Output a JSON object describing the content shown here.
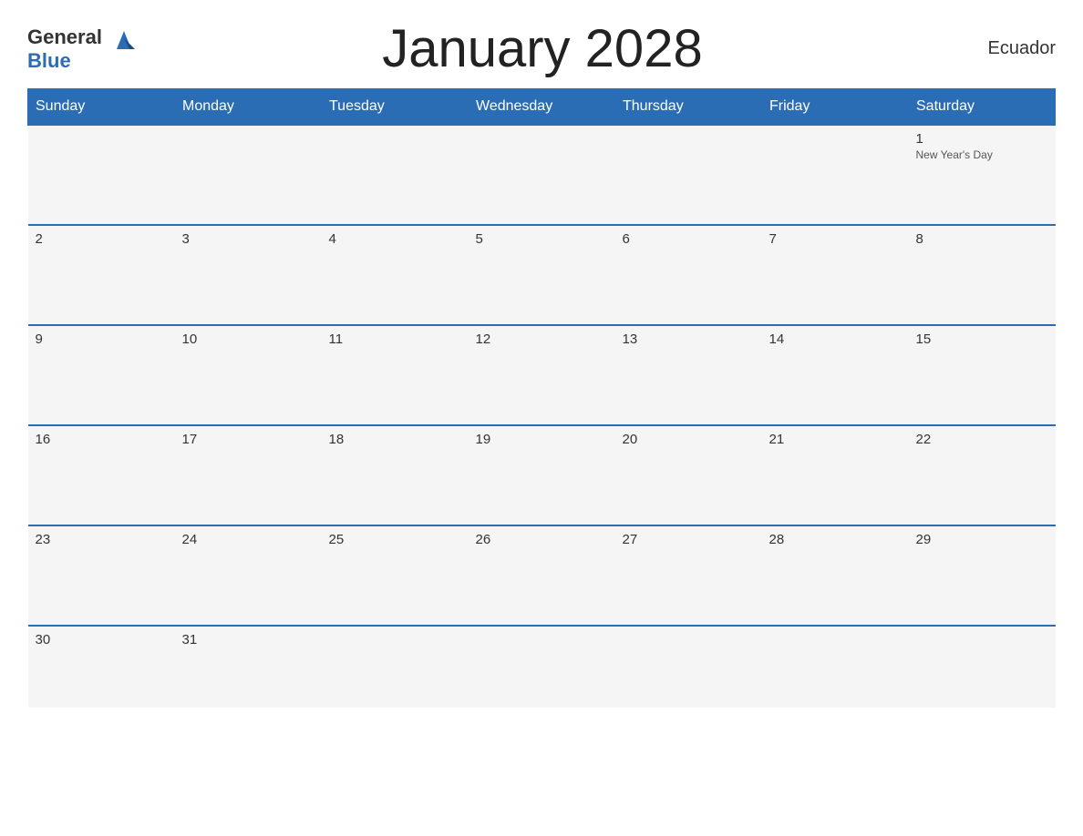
{
  "header": {
    "title": "January 2028",
    "country": "Ecuador",
    "logo": {
      "general": "General",
      "blue": "Blue"
    }
  },
  "days_of_week": [
    "Sunday",
    "Monday",
    "Tuesday",
    "Wednesday",
    "Thursday",
    "Friday",
    "Saturday"
  ],
  "weeks": [
    [
      {
        "day": "",
        "holiday": ""
      },
      {
        "day": "",
        "holiday": ""
      },
      {
        "day": "",
        "holiday": ""
      },
      {
        "day": "",
        "holiday": ""
      },
      {
        "day": "",
        "holiday": ""
      },
      {
        "day": "",
        "holiday": ""
      },
      {
        "day": "1",
        "holiday": "New Year's Day"
      }
    ],
    [
      {
        "day": "2",
        "holiday": ""
      },
      {
        "day": "3",
        "holiday": ""
      },
      {
        "day": "4",
        "holiday": ""
      },
      {
        "day": "5",
        "holiday": ""
      },
      {
        "day": "6",
        "holiday": ""
      },
      {
        "day": "7",
        "holiday": ""
      },
      {
        "day": "8",
        "holiday": ""
      }
    ],
    [
      {
        "day": "9",
        "holiday": ""
      },
      {
        "day": "10",
        "holiday": ""
      },
      {
        "day": "11",
        "holiday": ""
      },
      {
        "day": "12",
        "holiday": ""
      },
      {
        "day": "13",
        "holiday": ""
      },
      {
        "day": "14",
        "holiday": ""
      },
      {
        "day": "15",
        "holiday": ""
      }
    ],
    [
      {
        "day": "16",
        "holiday": ""
      },
      {
        "day": "17",
        "holiday": ""
      },
      {
        "day": "18",
        "holiday": ""
      },
      {
        "day": "19",
        "holiday": ""
      },
      {
        "day": "20",
        "holiday": ""
      },
      {
        "day": "21",
        "holiday": ""
      },
      {
        "day": "22",
        "holiday": ""
      }
    ],
    [
      {
        "day": "23",
        "holiday": ""
      },
      {
        "day": "24",
        "holiday": ""
      },
      {
        "day": "25",
        "holiday": ""
      },
      {
        "day": "26",
        "holiday": ""
      },
      {
        "day": "27",
        "holiday": ""
      },
      {
        "day": "28",
        "holiday": ""
      },
      {
        "day": "29",
        "holiday": ""
      }
    ],
    [
      {
        "day": "30",
        "holiday": ""
      },
      {
        "day": "31",
        "holiday": ""
      },
      {
        "day": "",
        "holiday": ""
      },
      {
        "day": "",
        "holiday": ""
      },
      {
        "day": "",
        "holiday": ""
      },
      {
        "day": "",
        "holiday": ""
      },
      {
        "day": "",
        "holiday": ""
      }
    ]
  ]
}
